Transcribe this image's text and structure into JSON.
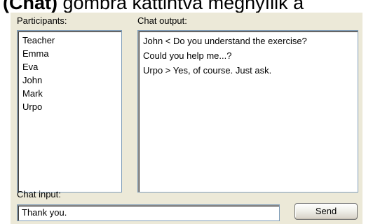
{
  "caption": {
    "bold_part": "(Chat)",
    "rest": " gombra kattintva megnyílik a"
  },
  "participants": {
    "label": "Participants:",
    "items": [
      "Teacher",
      "Emma",
      "Eva",
      "John",
      "Mark",
      "Urpo"
    ]
  },
  "chat_output": {
    "label": "Chat output:",
    "lines": [
      "John <  Do you understand the exercise?",
      "Could you help me...?",
      " Urpo > Yes, of course. Just ask."
    ]
  },
  "chat_input": {
    "label": "Chat input:",
    "value": "Thank you."
  },
  "send_button": {
    "label": "Send"
  }
}
